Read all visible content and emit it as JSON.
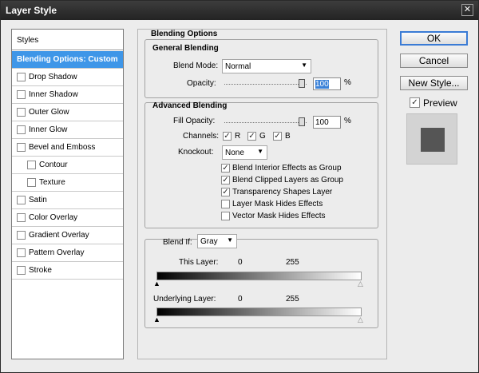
{
  "window": {
    "title": "Layer Style",
    "close_glyph": "✕"
  },
  "styles_list": {
    "header": "Styles",
    "items": [
      {
        "label": "Blending Options: Custom",
        "selected": true,
        "has_checkbox": false,
        "indent": false
      },
      {
        "label": "Drop Shadow",
        "has_checkbox": true,
        "checked": false,
        "indent": false
      },
      {
        "label": "Inner Shadow",
        "has_checkbox": true,
        "checked": false,
        "indent": false
      },
      {
        "label": "Outer Glow",
        "has_checkbox": true,
        "checked": false,
        "indent": false
      },
      {
        "label": "Inner Glow",
        "has_checkbox": true,
        "checked": false,
        "indent": false
      },
      {
        "label": "Bevel and Emboss",
        "has_checkbox": true,
        "checked": false,
        "indent": false
      },
      {
        "label": "Contour",
        "has_checkbox": true,
        "checked": false,
        "indent": true
      },
      {
        "label": "Texture",
        "has_checkbox": true,
        "checked": false,
        "indent": true
      },
      {
        "label": "Satin",
        "has_checkbox": true,
        "checked": false,
        "indent": false
      },
      {
        "label": "Color Overlay",
        "has_checkbox": true,
        "checked": false,
        "indent": false
      },
      {
        "label": "Gradient Overlay",
        "has_checkbox": true,
        "checked": false,
        "indent": false
      },
      {
        "label": "Pattern Overlay",
        "has_checkbox": true,
        "checked": false,
        "indent": false
      },
      {
        "label": "Stroke",
        "has_checkbox": true,
        "checked": false,
        "indent": false
      }
    ]
  },
  "blending": {
    "title": "Blending Options",
    "general": {
      "title": "General Blending",
      "blend_mode_label": "Blend Mode:",
      "blend_mode_value": "Normal",
      "opacity_label": "Opacity:",
      "opacity_value": "100",
      "opacity_unit": "%"
    },
    "advanced": {
      "title": "Advanced Blending",
      "fill_opacity_label": "Fill Opacity:",
      "fill_opacity_value": "100",
      "fill_opacity_unit": "%",
      "channels_label": "Channels:",
      "channels": [
        {
          "name": "R",
          "checked": true
        },
        {
          "name": "G",
          "checked": true
        },
        {
          "name": "B",
          "checked": true
        }
      ],
      "knockout_label": "Knockout:",
      "knockout_value": "None",
      "options": [
        {
          "label": "Blend Interior Effects as Group",
          "checked": true
        },
        {
          "label": "Blend Clipped Layers as Group",
          "checked": true
        },
        {
          "label": "Transparency Shapes Layer",
          "checked": true
        },
        {
          "label": "Layer Mask Hides Effects",
          "checked": false
        },
        {
          "label": "Vector Mask Hides Effects",
          "checked": false
        }
      ]
    },
    "blend_if": {
      "label": "Blend If:",
      "value": "Gray",
      "this_layer_label": "This Layer:",
      "this_layer_min": "0",
      "this_layer_max": "255",
      "underlying_label": "Underlying Layer:",
      "underlying_min": "0",
      "underlying_max": "255"
    }
  },
  "buttons": {
    "ok": "OK",
    "cancel": "Cancel",
    "new_style": "New Style...",
    "preview_label": "Preview",
    "preview_checked": true
  },
  "glyphs": {
    "check": "✓",
    "arrow_down": "▼"
  }
}
